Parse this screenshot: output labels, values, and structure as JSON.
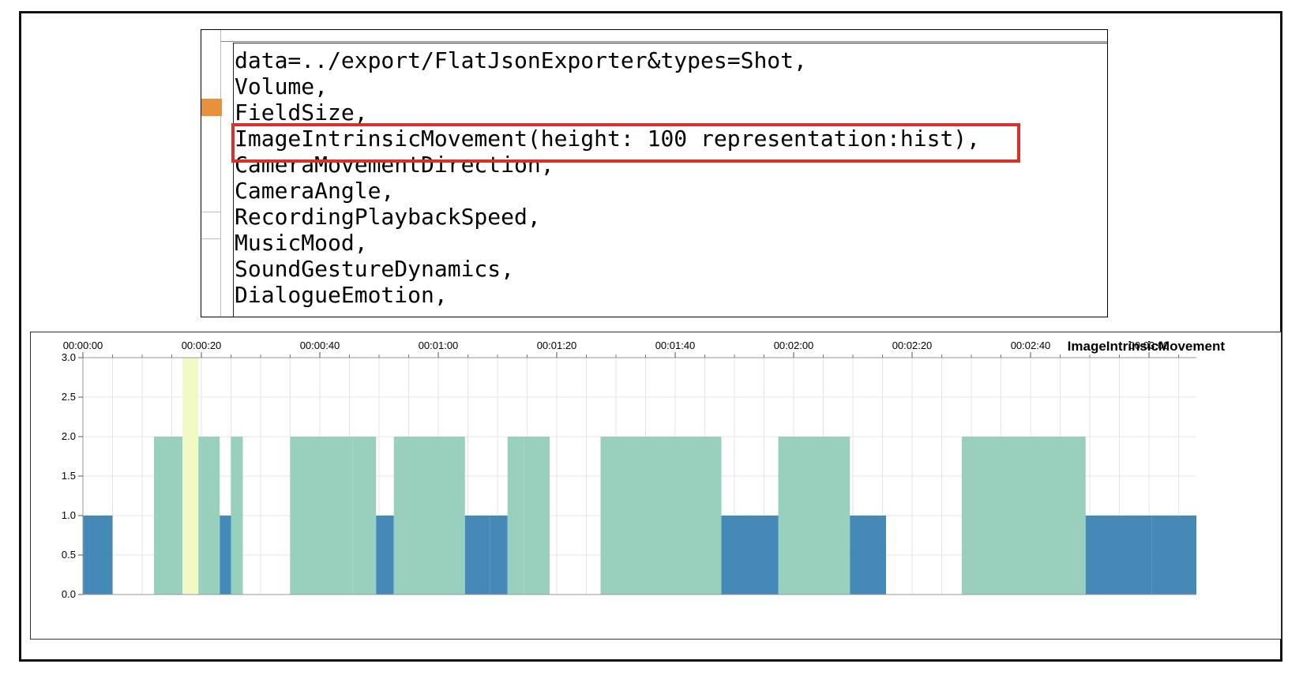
{
  "code_editor": {
    "lines": [
      "data=../export/FlatJsonExporter&types=Shot,",
      "Volume,",
      "FieldSize,",
      "ImageIntrinsicMovement(height: 100 representation:hist),",
      "CameraMovementDirection,",
      "CameraAngle,",
      "RecordingPlaybackSpeed,",
      "MusicMood,",
      "SoundGestureDynamics,",
      "DialogueEmotion,"
    ],
    "highlight_line_index": 3,
    "highlight_color": "#d7322a",
    "marker_color": "#e8913b"
  },
  "chart_data": {
    "type": "bar",
    "title": "ImageIntrinsicMovement",
    "x_unit": "seconds",
    "xlim": [
      0,
      188
    ],
    "ylim": [
      0,
      3
    ],
    "y_ticks": [
      0.0,
      0.5,
      1.0,
      1.5,
      2.0,
      2.5,
      3.0
    ],
    "y_tick_labels": [
      "0.0",
      "0.5",
      "1.0",
      "1.5",
      "2.0",
      "2.5",
      "3.0"
    ],
    "x_ticks": [
      0,
      20,
      40,
      60,
      80,
      100,
      120,
      140,
      160,
      180
    ],
    "x_tick_labels": [
      "00:00:00",
      "00:00:20",
      "00:00:40",
      "00:01:00",
      "00:01:20",
      "00:01:40",
      "00:02:00",
      "00:02:20",
      "00:02:40",
      "00:03:00"
    ],
    "grid": true,
    "colors": {
      "1": "#4589b8",
      "2": "#98d0bd",
      "3": "#f0f9c3"
    },
    "bars": [
      {
        "start": 0.0,
        "end": 5.0,
        "value": 1
      },
      {
        "start": 12.0,
        "end": 16.8,
        "value": 2
      },
      {
        "start": 16.8,
        "end": 19.5,
        "value": 3
      },
      {
        "start": 19.5,
        "end": 23.1,
        "value": 2
      },
      {
        "start": 23.1,
        "end": 25.0,
        "value": 1
      },
      {
        "start": 25.0,
        "end": 27.0,
        "value": 2
      },
      {
        "start": 35.0,
        "end": 45.5,
        "value": 2
      },
      {
        "start": 45.5,
        "end": 49.5,
        "value": 2
      },
      {
        "start": 49.5,
        "end": 52.5,
        "value": 1
      },
      {
        "start": 52.5,
        "end": 64.5,
        "value": 2
      },
      {
        "start": 64.5,
        "end": 67.2,
        "value": 1
      },
      {
        "start": 67.2,
        "end": 68.7,
        "value": 1
      },
      {
        "start": 68.7,
        "end": 71.7,
        "value": 1
      },
      {
        "start": 71.7,
        "end": 74.5,
        "value": 2
      },
      {
        "start": 74.5,
        "end": 78.8,
        "value": 2
      },
      {
        "start": 87.4,
        "end": 107.8,
        "value": 2
      },
      {
        "start": 107.8,
        "end": 110.0,
        "value": 1
      },
      {
        "start": 110.0,
        "end": 117.4,
        "value": 1
      },
      {
        "start": 117.4,
        "end": 129.5,
        "value": 2
      },
      {
        "start": 129.5,
        "end": 133.0,
        "value": 1
      },
      {
        "start": 133.0,
        "end": 135.6,
        "value": 1
      },
      {
        "start": 148.4,
        "end": 169.3,
        "value": 2
      },
      {
        "start": 169.3,
        "end": 180.5,
        "value": 1
      },
      {
        "start": 180.5,
        "end": 188.0,
        "value": 1
      }
    ]
  }
}
